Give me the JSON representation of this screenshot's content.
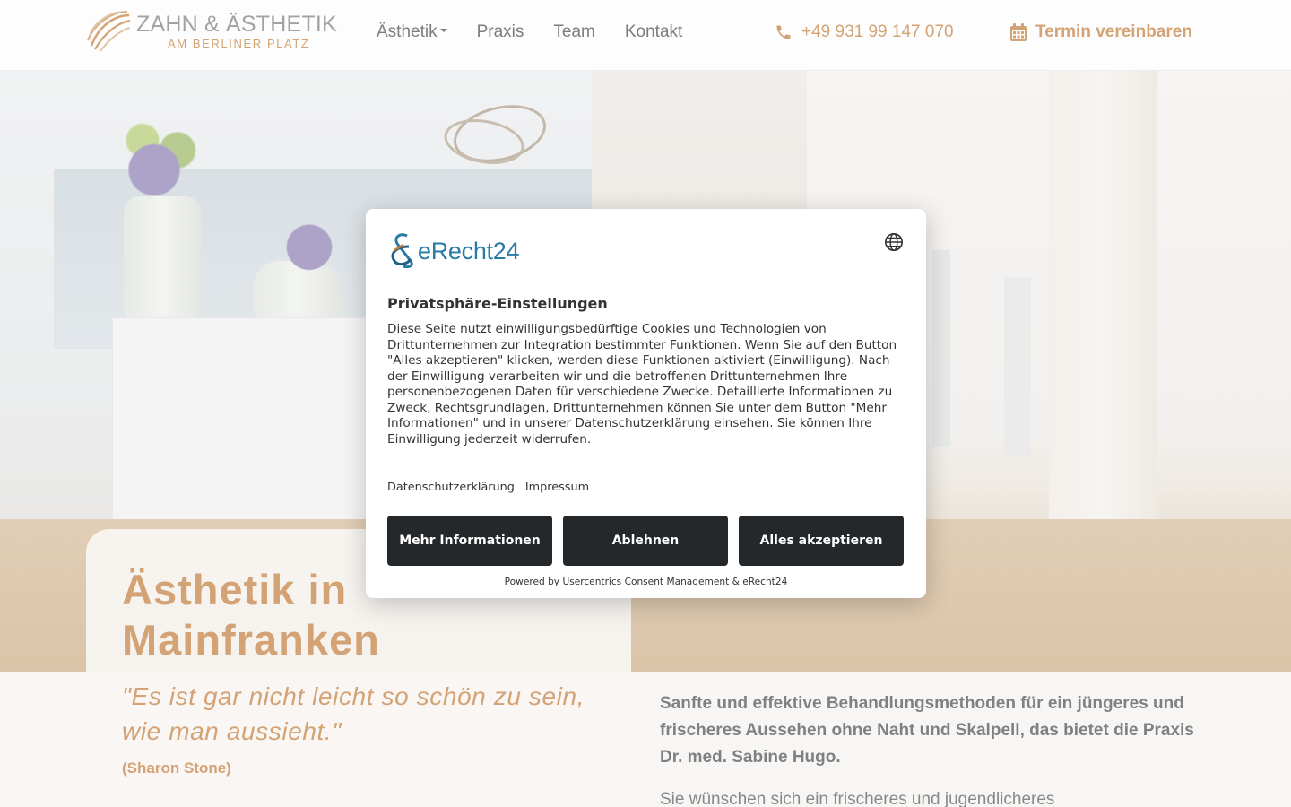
{
  "header": {
    "logo": {
      "line1": "ZAHN & ÄSTHETIK",
      "line2": "AM BERLINER PLATZ"
    },
    "nav": [
      {
        "label": "Ästhetik",
        "has_dropdown": true
      },
      {
        "label": "Praxis"
      },
      {
        "label": "Team"
      },
      {
        "label": "Kontakt"
      }
    ],
    "phone": {
      "icon": "phone-icon",
      "label": "+49 931 99 147 070"
    },
    "appointment": {
      "icon": "calendar-icon",
      "label": "Termin vereinbaren"
    }
  },
  "hero": {
    "title": "Ästhetik in Mainfranken",
    "quote": "\"Es ist gar nicht leicht so schön zu sein, wie man aussieht.\"",
    "quote_author": "(Sharon Stone)",
    "intro_bold": "Sanfte und effektive Behandlungsmethoden für ein jüngeres und frischeres Aussehen ohne Naht und Skalpell, das bietet die Praxis Dr. med. Sabine Hugo.",
    "intro_text": "Sie wünschen sich ein frischeres und jugendlicheres"
  },
  "consent": {
    "brand": "eRecht24",
    "language_icon": "globe-icon",
    "title": "Privatsphäre-Einstellungen",
    "body": "Diese Seite nutzt einwilligungsbedürftige Cookies und Technologien von Drittunternehmen zur Integration bestimmter Funktionen. Wenn Sie auf den Button \"Alles akzeptieren\" klicken, werden diese Funktionen aktiviert (Einwilligung). Nach der Einwilligung verarbeiten wir und die betroffenen Drittunternehmen Ihre personenbezogenen Daten für verschiedene Zwecke. Detaillierte Informationen zu Zweck, Rechtsgrundlagen, Drittunternehmen können Sie unter dem Button \"Mehr Informationen\" und in unserer Datenschutzerklärung einsehen. Sie können Ihre Einwilligung jederzeit widerrufen.",
    "links": {
      "privacy": "Datenschutzerklärung",
      "imprint": "Impressum"
    },
    "buttons": {
      "more_info": "Mehr Informationen",
      "decline": "Ablehnen",
      "accept_all": "Alles akzeptieren"
    },
    "powered_by": "Powered by Usercentrics Consent Management & eRecht24"
  },
  "colors": {
    "accent": "#c27b3a",
    "button_dark": "#24282b",
    "erecht_blue": "#2a7aa6"
  }
}
